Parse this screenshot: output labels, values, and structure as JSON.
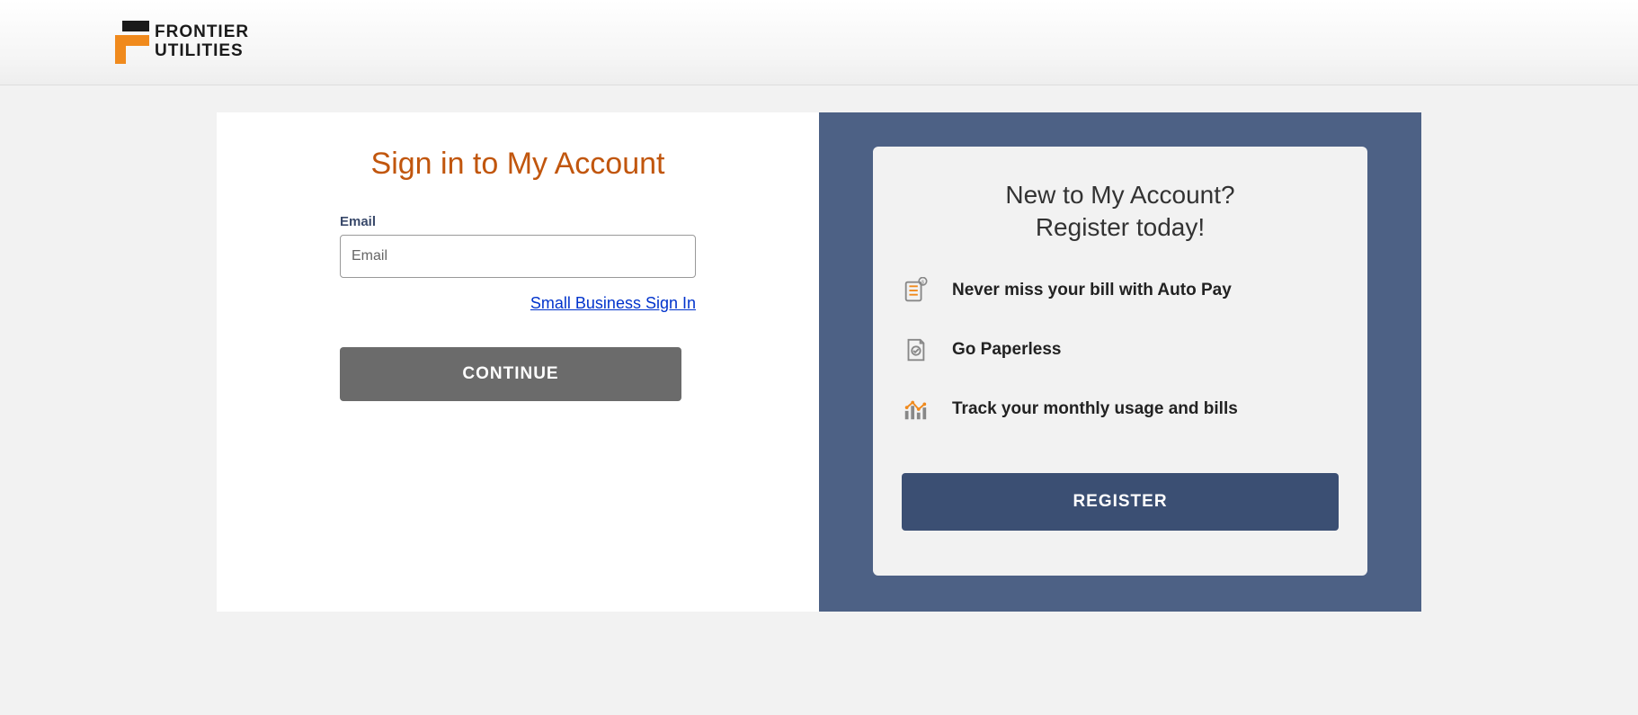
{
  "brand": {
    "line1": "FRONTIER",
    "line2": "UTILITIES"
  },
  "signin": {
    "title": "Sign in to My Account",
    "email_label": "Email",
    "email_placeholder": "Email",
    "small_biz_link": "Small Business Sign In",
    "continue": "CONTINUE"
  },
  "register": {
    "title_line1": "New to My Account?",
    "title_line2": "Register today!",
    "benefits": [
      "Never miss your bill with Auto Pay",
      "Go Paperless",
      "Track your monthly usage and bills"
    ],
    "button": "REGISTER"
  }
}
